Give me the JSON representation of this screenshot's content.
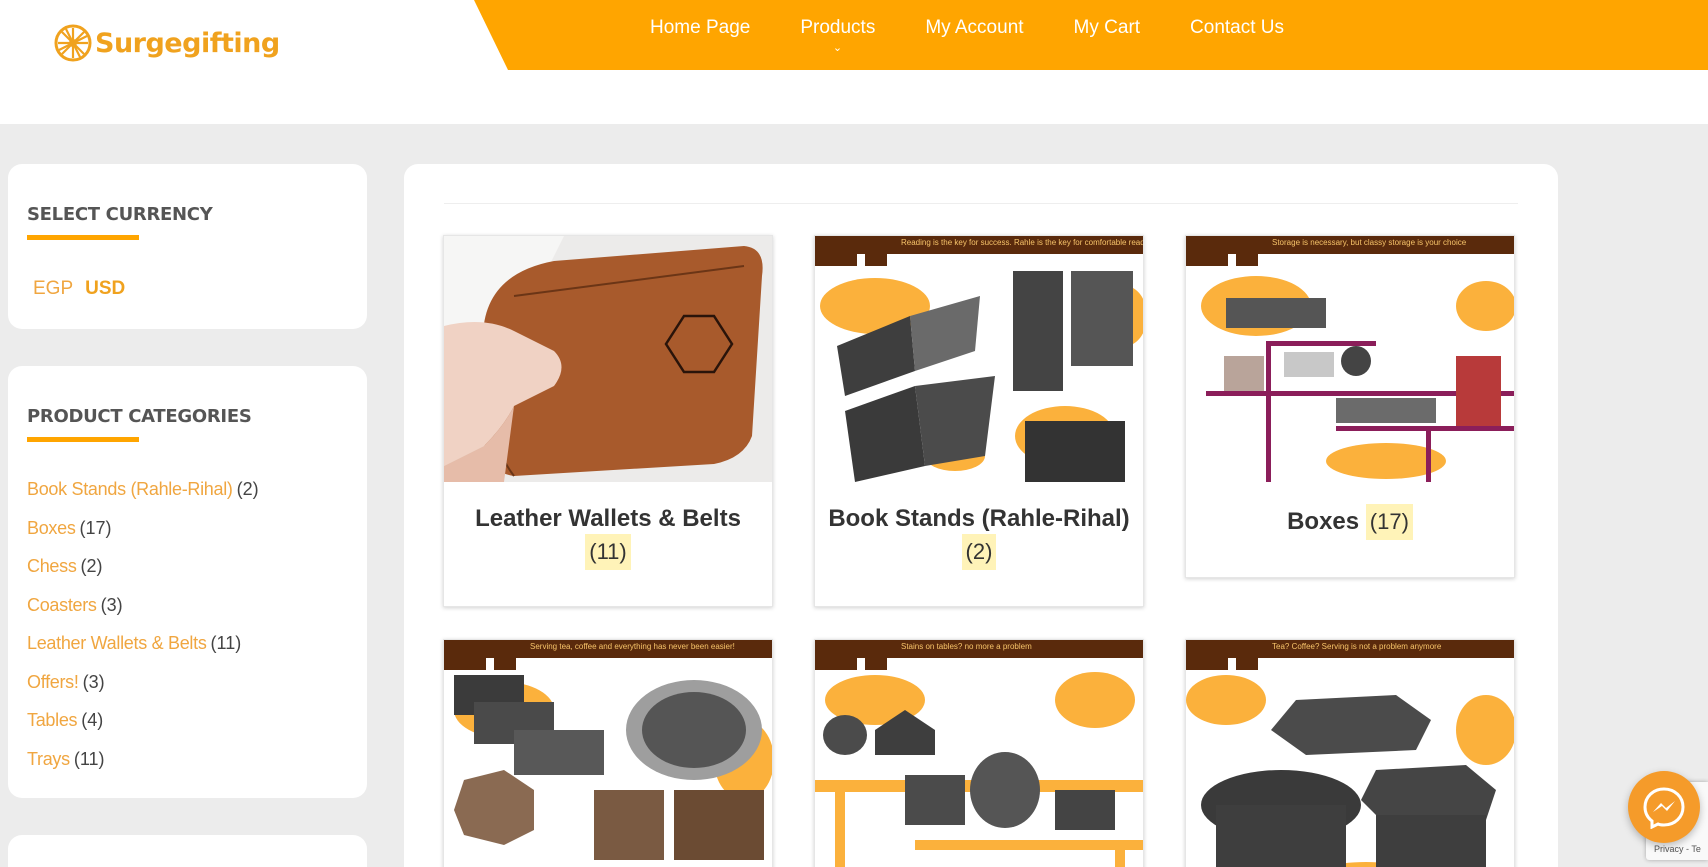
{
  "brand": {
    "name": "Surgegifting"
  },
  "nav": {
    "items": [
      "Home Page",
      "Products",
      "My Account",
      "My Cart",
      "Contact Us"
    ]
  },
  "currency_widget": {
    "title": "Select Currency",
    "options": [
      "EGP",
      "USD"
    ],
    "selected": "USD"
  },
  "categories_widget": {
    "title": "Product Categories",
    "items": [
      {
        "name": "Book Stands (Rahle-Rihal)",
        "count": "(2)"
      },
      {
        "name": "Boxes",
        "count": "(17)"
      },
      {
        "name": "Chess",
        "count": "(2)"
      },
      {
        "name": "Coasters",
        "count": "(3)"
      },
      {
        "name": "Leather Wallets & Belts",
        "count": "(11)"
      },
      {
        "name": "Offers!",
        "count": "(3)"
      },
      {
        "name": "Tables",
        "count": "(4)"
      },
      {
        "name": "Trays",
        "count": "(11)"
      }
    ]
  },
  "products": [
    {
      "title": "Leather Wallets & Belts",
      "count": "(11)",
      "image": "leather-wallet-photo"
    },
    {
      "title": "Book Stands (Rahle-Rihal)",
      "count": "(2)",
      "image": "book-stands-poster",
      "banner": "Reading is the key for success. Rahle is the key for comfortable reading"
    },
    {
      "title": "Boxes",
      "count": "(17)",
      "image": "boxes-poster",
      "banner": "Storage is necessary, but classy storage is your choice"
    },
    {
      "image": "trays-poster",
      "banner": "Serving tea, coffee and everything has never been easier!"
    },
    {
      "image": "coasters-poster",
      "banner": "Stains on tables? no more a problem"
    },
    {
      "image": "tables-poster",
      "banner": "Tea? Coffee? Serving is not a problem anymore"
    }
  ],
  "colors": {
    "accent": "#ffa500",
    "link": "#f0a640",
    "badge": "#fff3b8",
    "background": "#ececec"
  },
  "recaptcha": {
    "text": "Privacy - Te"
  }
}
